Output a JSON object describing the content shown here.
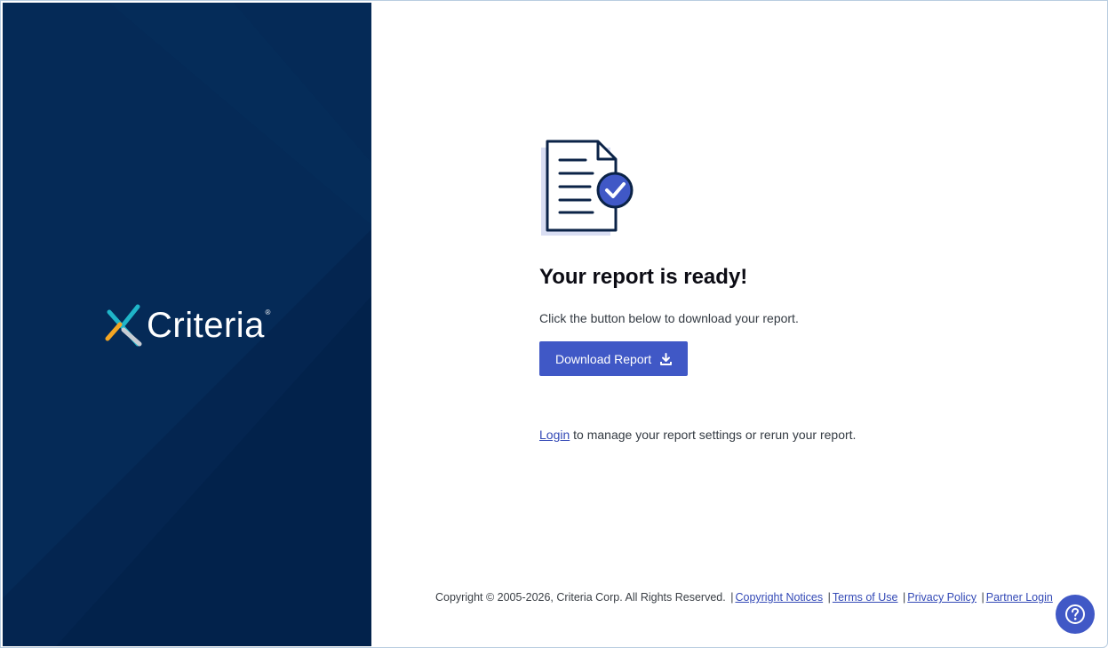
{
  "brand": {
    "logo_text": "Criteria",
    "registered_mark": "®",
    "colors": {
      "panel": "#052a57",
      "accent_teal": "#1fb5c9",
      "accent_orange": "#f5a623",
      "accent_gray": "#c7ccd3"
    }
  },
  "main": {
    "icon": "report-check-icon",
    "title": "Your report is ready!",
    "subtitle": "Click the button below to download your report.",
    "download_label": "Download Report",
    "login_link": "Login",
    "login_text": " to manage your report settings or rerun your report."
  },
  "footer": {
    "copyright": "Copyright © 2005-2026, Criteria Corp. All Rights Reserved.",
    "sep": "|",
    "links": [
      "Copyright Notices",
      "Terms of Use",
      "Privacy Policy",
      "Partner Login"
    ]
  },
  "help": {
    "icon": "question-icon"
  },
  "accent_color": "#4058c6"
}
